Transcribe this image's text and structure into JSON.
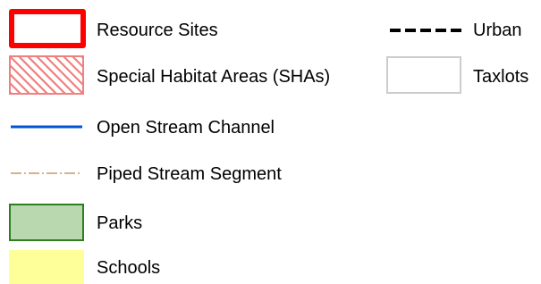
{
  "legend": {
    "items": [
      {
        "label": "Resource Sites",
        "symbol": "outlined-box",
        "outline_color": "#ff0000",
        "fill_color": "#ffffff"
      },
      {
        "label": "Special Habitat Areas (SHAs)",
        "symbol": "hatched-box",
        "outline_color": "#f08080",
        "hatch_color": "#f08080",
        "fill_color": "#ffffff"
      },
      {
        "label": "Open Stream Channel",
        "symbol": "solid-line",
        "color": "#0055d4"
      },
      {
        "label": "Piped Stream Segment",
        "symbol": "dash-dot-line",
        "color": "#d2b48c"
      },
      {
        "label": "Parks",
        "symbol": "filled-box",
        "outline_color": "#2e7d1e",
        "fill_color": "#b9d8b0"
      },
      {
        "label": "Schools",
        "symbol": "filled-box",
        "outline_color": "#ffff99",
        "fill_color": "#ffff99"
      },
      {
        "label": "Urban",
        "symbol": "dashed-line",
        "color": "#000000"
      },
      {
        "label": "Taxlots",
        "symbol": "outlined-box",
        "outline_color": "#cccccc",
        "fill_color": "#ffffff"
      }
    ]
  }
}
